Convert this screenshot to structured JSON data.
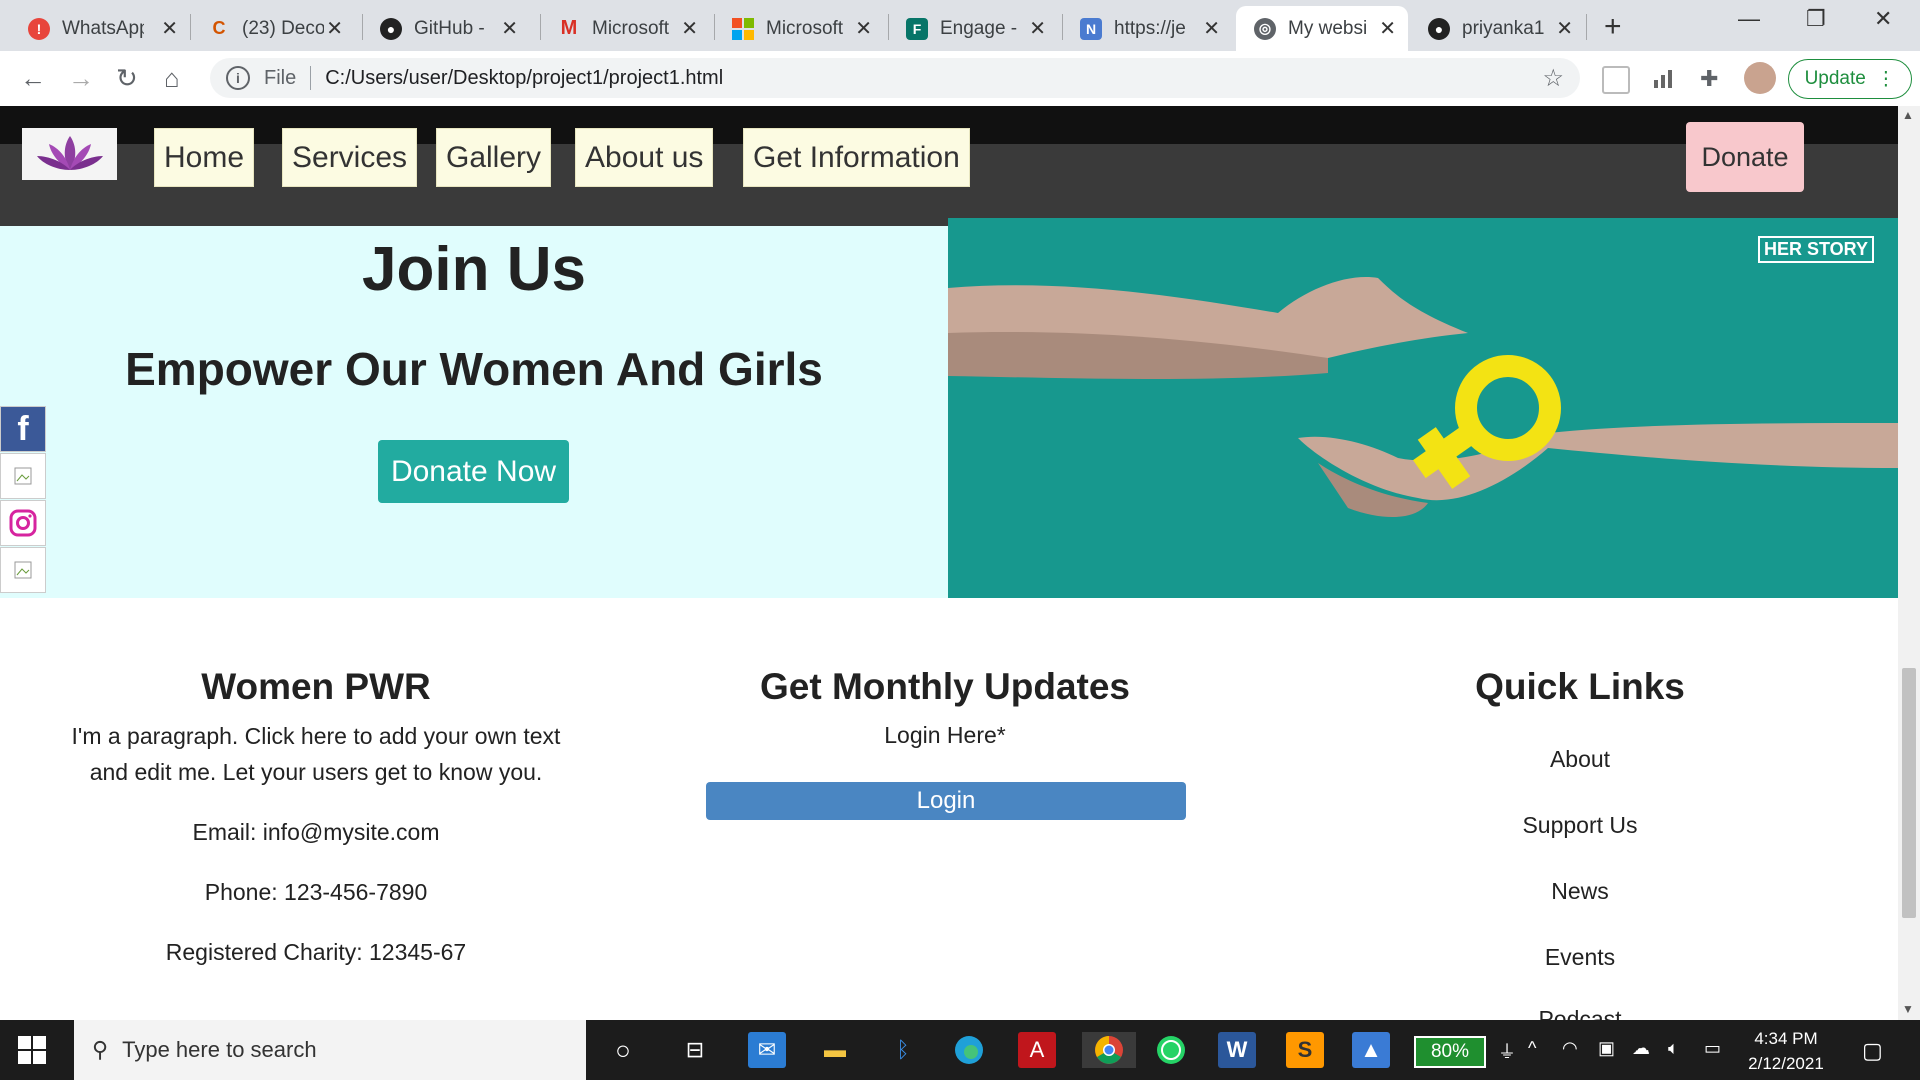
{
  "browser": {
    "tabs": [
      {
        "title": "WhatsApp",
        "icon": "whatsapp-icon",
        "active": false
      },
      {
        "title": "(23) Deco",
        "icon": "decode-icon",
        "active": false
      },
      {
        "title": "GitHub - ",
        "icon": "github-icon",
        "active": false
      },
      {
        "title": "Microsoft",
        "icon": "gmail-icon",
        "active": false
      },
      {
        "title": "Microsoft",
        "icon": "microsoft-icon",
        "active": false
      },
      {
        "title": "Engage - ",
        "icon": "forms-icon",
        "active": false
      },
      {
        "title": "https://je",
        "icon": "site-icon",
        "active": false
      },
      {
        "title": "My websi",
        "icon": "globe-icon",
        "active": true
      },
      {
        "title": "priyanka1",
        "icon": "github-icon",
        "active": false
      }
    ],
    "address": {
      "scheme": "File",
      "url": "C:/Users/user/Desktop/project1/project1.html"
    },
    "update_label": "Update"
  },
  "site": {
    "nav": {
      "links": [
        "Home",
        "Services",
        "Gallery",
        "About us",
        "Get Information"
      ],
      "donate": "Donate"
    },
    "hero": {
      "title": "Join Us",
      "subtitle": "Empower Our Women And Girls",
      "cta": "Donate Now",
      "image_badge": "HER STORY"
    },
    "footer": {
      "about": {
        "heading": "Women PWR",
        "paragraph": "I'm a paragraph. Click here to add your own text and edit me. Let your users get to know you.",
        "email": "Email: info@mysite.com",
        "phone": "Phone: 123-456-7890",
        "charity": "Registered Charity: 12345-67"
      },
      "updates": {
        "heading": "Get Monthly Updates",
        "login_prompt": "Login Here*",
        "login_button": "Login"
      },
      "quick_links": {
        "heading": "Quick Links",
        "links": [
          "About",
          "Support Us",
          "News",
          "Events",
          "Podcast"
        ]
      }
    }
  },
  "taskbar": {
    "search_placeholder": "Type here to search",
    "battery": "80%",
    "time": "4:34 PM",
    "date": "2/12/2021"
  },
  "colors": {
    "hero_bg": "#e0fdfd",
    "teal_button": "#22aba0",
    "login_button": "#4a86c2",
    "donate_nav": "#f8c8cc",
    "nav_link_bg": "#fcfbe2"
  }
}
